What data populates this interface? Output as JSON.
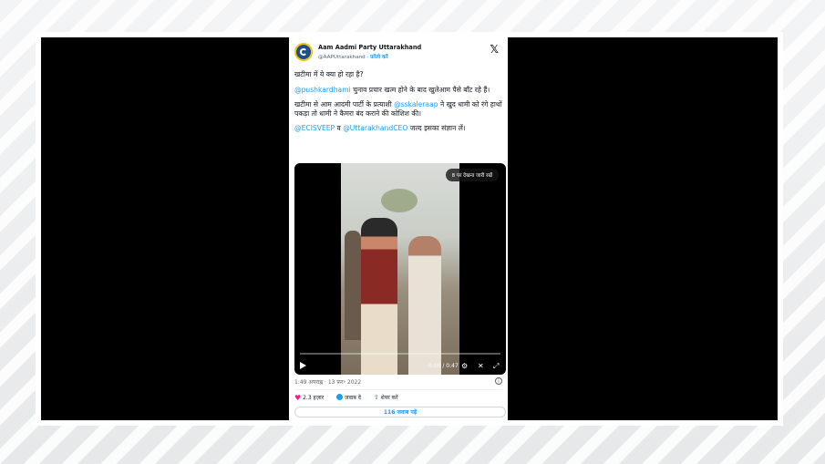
{
  "tweet": {
    "account_name": "Aam Aadmi Party Uttarakhand",
    "handle": "@AAPUttarakhand",
    "separator": " · ",
    "follow_label": "फ़ॉलो करें",
    "line1": "खटीमा में ये क्या हो रहा है?",
    "p2_mention": "@pushkardhami",
    "p2_text": " चुनाव प्रचार खत्म होने के बाद खुलेआम पैसे बाँट रहे हैं।",
    "p3_text_a": "खटीमा से आम आदमी पार्टी के प्रत्याशी ",
    "p3_mention": "@sskaleraap",
    "p3_text_b": " ने खुद धामी को रंगे हाथों पकड़ा तो धामी ने कैमरा बंद कराने की कोशिश की।",
    "p4_mention_a": "@ECISVEEP",
    "p4_text_a": " व ",
    "p4_mention_b": "@UttarakhandCEO",
    "p4_text_b": " जल्द इसका संज्ञान लें।",
    "timestamp": "1:49 अपराह्न · 13 फ़र॰ 2022",
    "likes": "2.3 हज़ार",
    "reply_label": "जवाब दें",
    "share_label": "शेयर करें",
    "replies_button": "116 जवाब पढ़ें"
  },
  "video": {
    "pill_text": "8 पर देखना जारी रखें",
    "timecode": "0:00 / 0:47",
    "progress": 0
  },
  "icons": {
    "x_logo": "x-logo-icon",
    "heart": "heart-icon",
    "reply": "reply-icon",
    "share": "share-icon",
    "play": "play-icon",
    "mute": "mute-icon",
    "fullscreen": "fullscreen-icon",
    "info": "info-icon"
  },
  "colors": {
    "accent": "#1d9bf0",
    "like": "#f91880",
    "text": "#0f1419",
    "muted": "#536471"
  }
}
